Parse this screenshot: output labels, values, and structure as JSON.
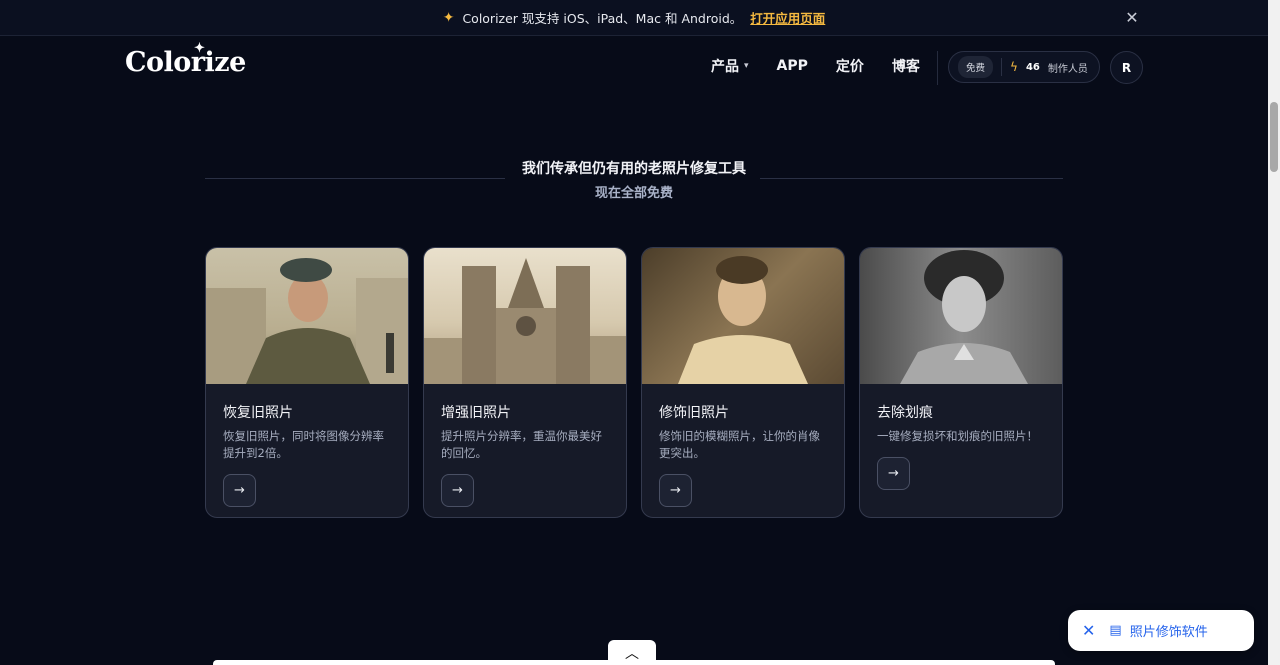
{
  "announcement": {
    "text": "Colorizer 现支持 iOS、iPad、Mac 和 Android。",
    "link": "打开应用页面"
  },
  "header": {
    "logo": "Colorize",
    "nav": [
      {
        "label": "产品"
      },
      {
        "label": "APP"
      },
      {
        "label": "定价"
      },
      {
        "label": "博客"
      }
    ],
    "credits": {
      "free": "免费",
      "count": "46",
      "label": "制作人员"
    },
    "avatar": "R"
  },
  "section": {
    "title": "我们传承但仍有用的老照片修复工具",
    "subtitle": "现在全部免费"
  },
  "cards": [
    {
      "title": "恢复旧照片",
      "desc": "恢复旧照片，同时将图像分辨率提升到2倍。"
    },
    {
      "title": "增强旧照片",
      "desc": "提升照片分辨率，重温你最美好的回忆。"
    },
    {
      "title": "修饰旧照片",
      "desc": "修饰旧的模糊照片，让你的肖像更突出。"
    },
    {
      "title": "去除划痕",
      "desc": "一键修复损坏和划痕的旧照片！"
    }
  ],
  "float_widget": {
    "label": "照片修饰软件"
  },
  "colors": {
    "background": "#070b18",
    "accent": "#f5b940",
    "link_blue": "#2563eb"
  }
}
